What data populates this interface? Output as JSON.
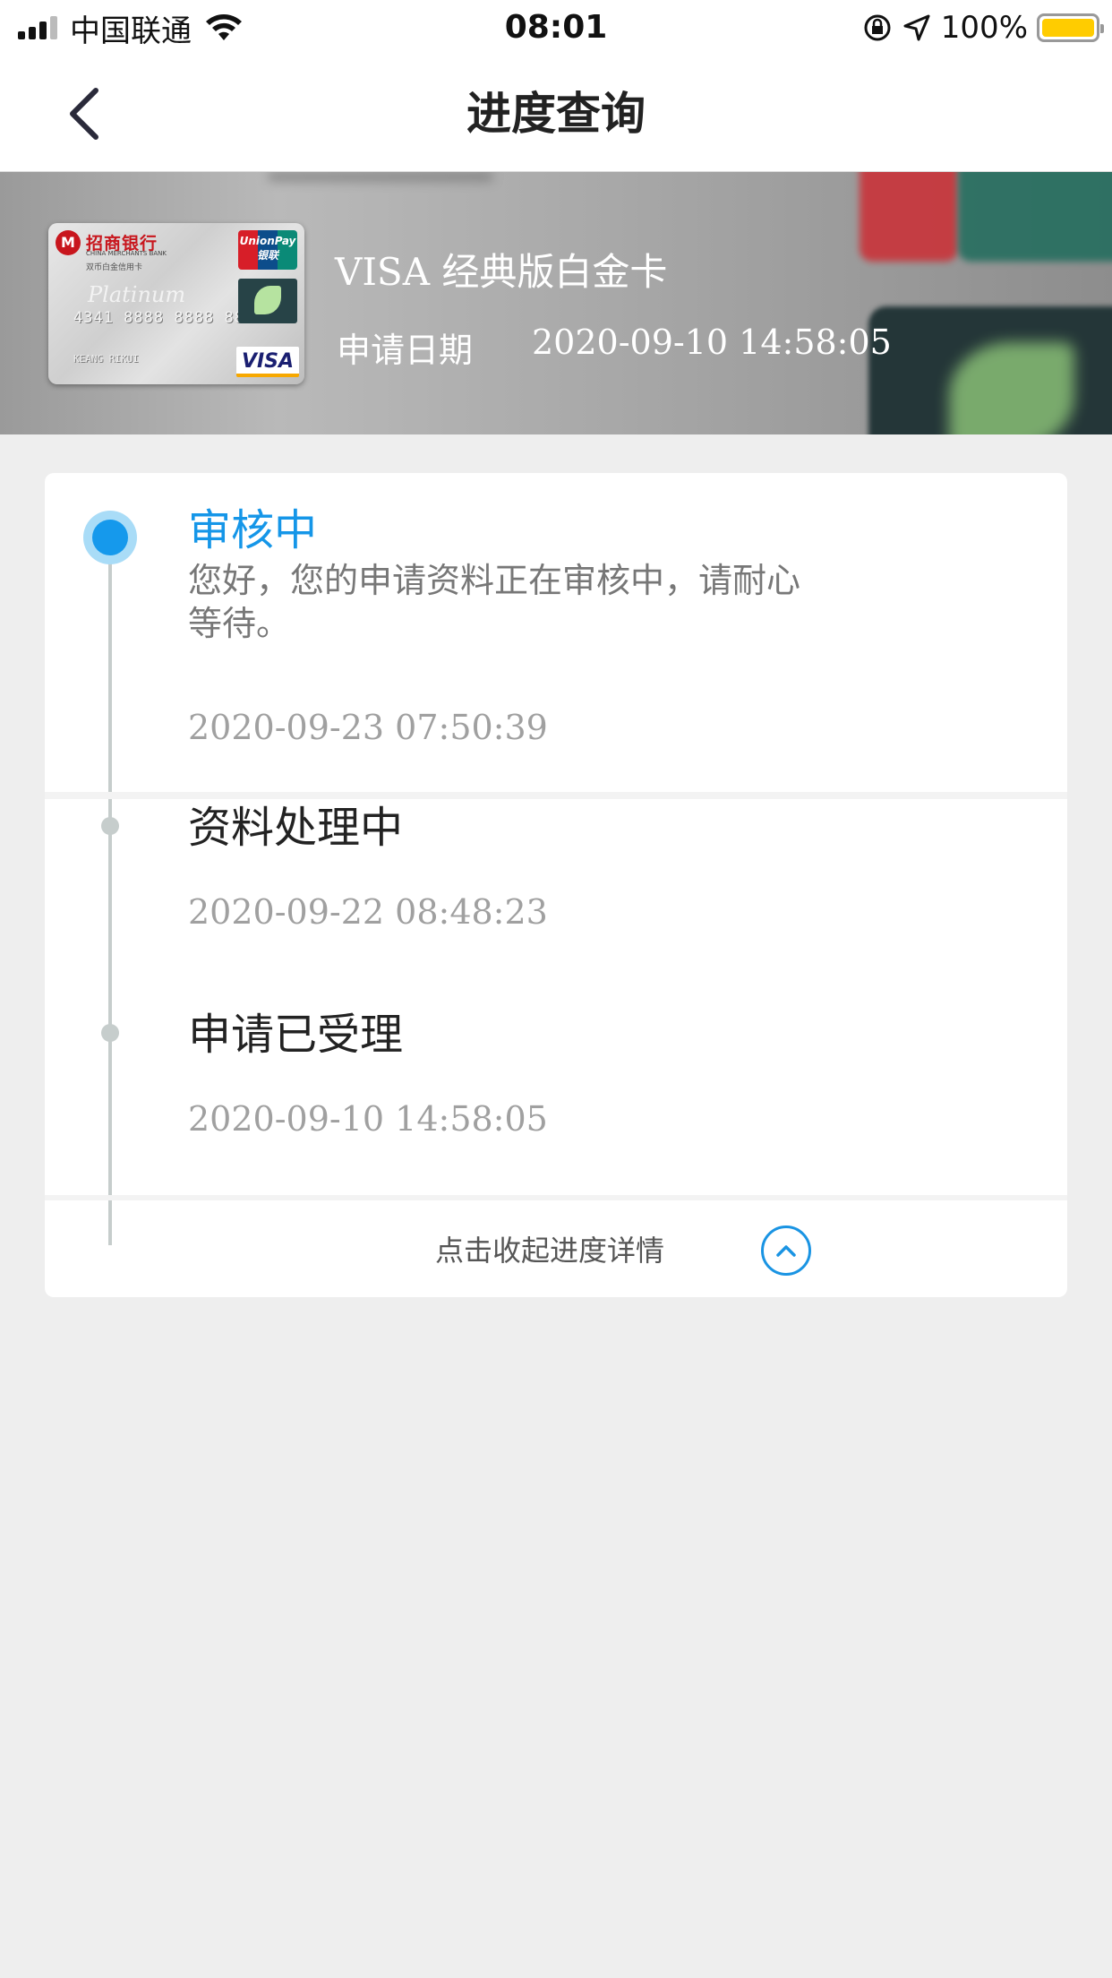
{
  "status_bar": {
    "carrier": "中国联通",
    "time": "08:01",
    "battery": "100%",
    "battery_level": 1.0
  },
  "nav": {
    "title": "进度查询",
    "back_icon": "chevron-left-icon"
  },
  "card": {
    "bank_name": "招商银行",
    "bank_en": "CHINA MERCHANTS BANK",
    "card_subtitle": "双币白金信用卡",
    "platinum": "Platinum",
    "number": "4341 8888 8888 8888",
    "holder": "KEANG RIKUI",
    "unionpay": "UnionPay 银联",
    "visa": "VISA",
    "title": "VISA 经典版白金卡",
    "apply_label": "申请日期",
    "apply_date": "2020-09-10 14:58:05"
  },
  "timeline": {
    "steps": [
      {
        "title": "审核中",
        "desc": "您好，您的申请资料正在审核中，请耐心等待。",
        "time": "2020-09-23 07:50:39",
        "active": true
      },
      {
        "title": "资料处理中",
        "time": "2020-09-22 08:48:23",
        "active": false
      },
      {
        "title": "申请已受理",
        "time": "2020-09-10 14:58:05",
        "active": false
      }
    ],
    "collapse_label": "点击收起进度详情",
    "collapse_icon": "chevron-up-circle-icon"
  },
  "colors": {
    "accent": "#1599ec",
    "background": "#eeeeee",
    "battery": "#ffcc00"
  }
}
